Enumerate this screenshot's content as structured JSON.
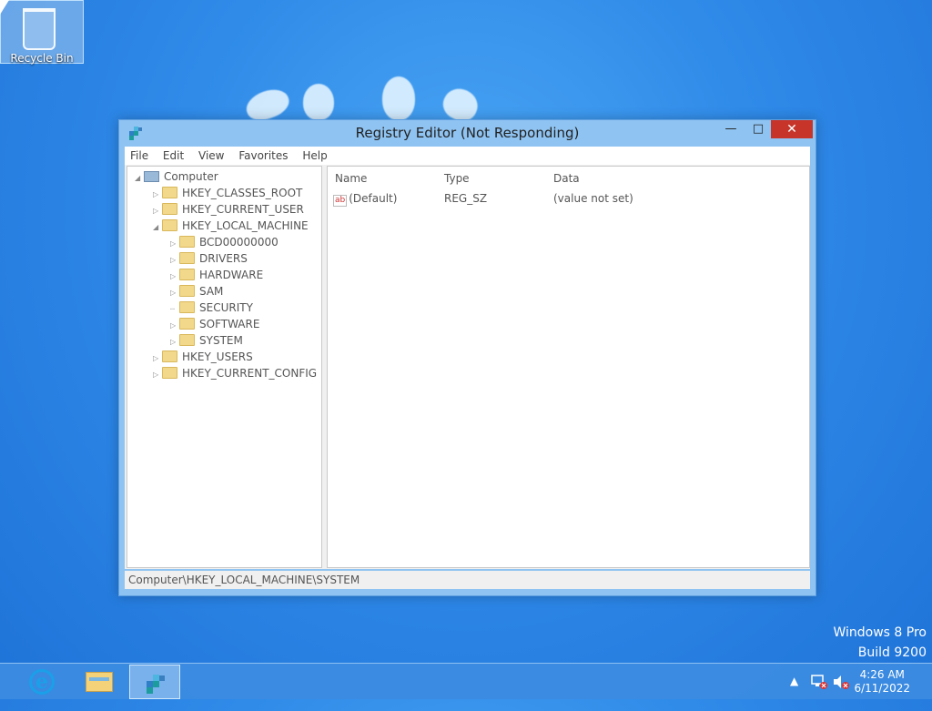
{
  "desktop": {
    "recycle_bin_label": "Recycle Bin",
    "watermark_line1": "Windows 8 Pro",
    "watermark_line2": "Build 9200"
  },
  "window": {
    "title": "Registry Editor (Not Responding)",
    "menu": [
      "File",
      "Edit",
      "View",
      "Favorites",
      "Help"
    ],
    "tree": {
      "root": "Computer",
      "hives": {
        "classes_root": "HKEY_CLASSES_ROOT",
        "current_user": "HKEY_CURRENT_USER",
        "local_machine": "HKEY_LOCAL_MACHINE",
        "users": "HKEY_USERS",
        "current_config": "HKEY_CURRENT_CONFIG"
      },
      "local_machine_children": [
        "BCD00000000",
        "DRIVERS",
        "HARDWARE",
        "SAM",
        "SECURITY",
        "SOFTWARE",
        "SYSTEM"
      ]
    },
    "columns": {
      "name": "Name",
      "type": "Type",
      "data": "Data"
    },
    "values": [
      {
        "name": "(Default)",
        "type": "REG_SZ",
        "data": "(value not set)",
        "icon": "string-value-icon"
      }
    ],
    "status_path": "Computer\\HKEY_LOCAL_MACHINE\\SYSTEM",
    "buttons": {
      "minimize": "—",
      "maximize": "□",
      "close": "✕"
    }
  },
  "taskbar": {
    "items": [
      "internet-explorer",
      "file-explorer",
      "registry-editor"
    ],
    "tray_expand": "▲",
    "time": "4:26 AM",
    "date": "6/11/2022"
  },
  "colors": {
    "desktop": "#2f8ae8",
    "close_button": "#c7352a",
    "window_frame": "#8fc3f1"
  }
}
